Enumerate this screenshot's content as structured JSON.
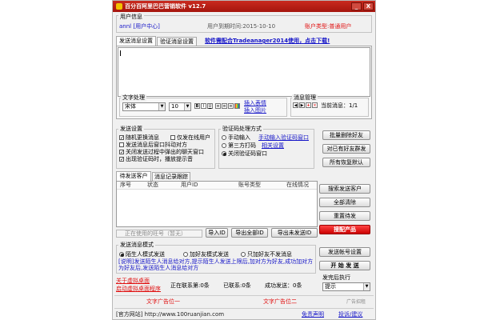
{
  "title": "百分百阿里巴巴营销软件 v12.7",
  "window_buttons": {
    "minimize": "_",
    "close": "X"
  },
  "user_info": {
    "group_label": "用户信息",
    "user": "annl [用户中心]",
    "expiry": "用户到期时间:2015-10-10",
    "account_type": "账户类型:普通用户"
  },
  "top_tabs": [
    "发送消息设置",
    "验证消息设置"
  ],
  "top_notice": "软件需配合Tradeanager2014使用，点击下载!",
  "text_group": {
    "label": "文字处理",
    "font": "宋体",
    "size": "10",
    "style_buttons": [
      "B",
      "I",
      "U"
    ],
    "insert_emoji": "插入表情",
    "insert_image": "插入图片"
  },
  "msg_mgmt": {
    "label": "消息管理",
    "current": "当前消息：1/1"
  },
  "send_settings": {
    "label": "发送设置",
    "options": [
      {
        "text": "随机更换消息",
        "checked": true
      },
      {
        "text": "仅发在线用户",
        "checked": false
      },
      {
        "text": "发送消息后窗口抖动对方",
        "checked": false
      },
      {
        "text": "关闭发送过程中弹出的聊天窗口",
        "checked": true
      },
      {
        "text": "出现验证码时，播放提示音",
        "checked": true
      }
    ]
  },
  "captcha": {
    "label": "验证码处理方式",
    "options": [
      {
        "text": "手动输入",
        "link": "手动输入验证码窗口",
        "checked": false
      },
      {
        "text": "第三方打码",
        "link": "相关设置",
        "checked": false
      },
      {
        "text": "关闭验证码窗口",
        "checked": true
      }
    ]
  },
  "right_buttons_1": [
    "批量删除好友",
    "对已有好友群发",
    "所有恢复默认"
  ],
  "list_tabs": [
    "待发送客户",
    "消息记录跟踪"
  ],
  "list_columns": [
    "序号",
    "状态",
    "用户ID",
    "账号类型",
    "在线情况"
  ],
  "account_placeholder": "正在使用的旺号（暂无）",
  "list_buttons": [
    "导入ID",
    "导出全部ID",
    "导出未发送ID"
  ],
  "right_buttons_2": [
    "搜索发送客户",
    "全部清除",
    "重置待发",
    "搜配产品"
  ],
  "mode": {
    "label": "发送消息模式",
    "options": [
      {
        "text": "陌生人模式发送",
        "checked": true
      },
      {
        "text": "加好友模式发送",
        "checked": false
      },
      {
        "text": "只加好友不发消息",
        "checked": false
      }
    ],
    "description": "[说明]发送陌生人消息给对方,提示陌生人发送上限后,加对方为好友,成功加对方为好友后,发送陌生人消息给对方"
  },
  "right_buttons_3": [
    "发送帐号设置",
    "开 始 发 送"
  ],
  "after_send": {
    "label": "发完后执行",
    "value": "提示"
  },
  "bottom_links": [
    "关于虚拟桌面",
    "启动虚拟桌面程序"
  ],
  "stats": {
    "sending": "正在联系第:0条",
    "sent": "已联系:0条",
    "success": "成功发送：0条"
  },
  "ads": [
    "文字广告位一",
    "文字广告位二"
  ],
  "ad_tag": "广告招租",
  "footer": {
    "website": "[官方网站] http://www.100ruanjian.com",
    "disclaimer": "免责声明",
    "complaint": "投诉/建议"
  }
}
